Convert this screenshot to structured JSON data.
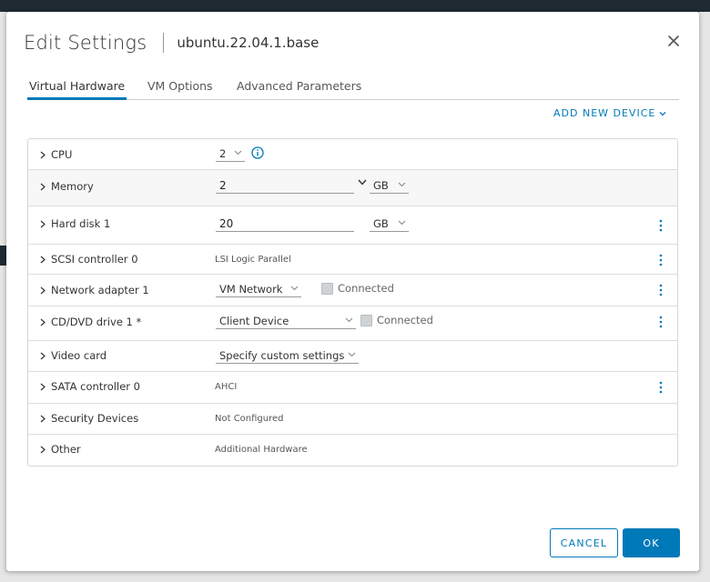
{
  "dialog": {
    "title": "Edit Settings",
    "subtitle": "ubuntu.22.04.1.base"
  },
  "tabs": [
    {
      "label": "Virtual Hardware",
      "active": true
    },
    {
      "label": "VM Options",
      "active": false
    },
    {
      "label": "Advanced Parameters",
      "active": false
    }
  ],
  "add_device_label": "ADD NEW DEVICE",
  "hardware": {
    "cpu": {
      "label": "CPU",
      "value": "2"
    },
    "memory": {
      "label": "Memory",
      "value": "2",
      "unit": "GB"
    },
    "hard_disk": {
      "label": "Hard disk 1",
      "value": "20",
      "unit": "GB"
    },
    "scsi": {
      "label": "SCSI controller 0",
      "value": "LSI Logic Parallel"
    },
    "network": {
      "label": "Network adapter 1",
      "value": "VM Network",
      "connected_label": "Connected"
    },
    "cdrom": {
      "label": "CD/DVD drive 1 *",
      "value": "Client Device",
      "connected_label": "Connected"
    },
    "video": {
      "label": "Video card",
      "value": "Specify custom settings"
    },
    "sata": {
      "label": "SATA controller 0",
      "value": "AHCI"
    },
    "security": {
      "label": "Security Devices",
      "value": "Not Configured"
    },
    "other": {
      "label": "Other",
      "value": "Additional Hardware"
    }
  },
  "footer": {
    "cancel_label": "CANCEL",
    "ok_label": "OK"
  },
  "colors": {
    "accent": "#0079b8",
    "text": "#333333",
    "row_shade": "#f7f7f7"
  },
  "icons": {
    "close": "close-icon",
    "expand": "chevron-right-icon",
    "dropdown": "chevron-down-icon",
    "info": "info-icon",
    "row_menu": "kebab-menu-icon"
  }
}
